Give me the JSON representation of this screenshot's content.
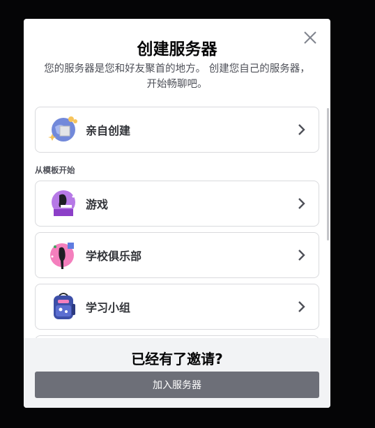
{
  "modal": {
    "title": "创建服务器",
    "subtitle": "您的服务器是您和好友聚首的地方。 创建您自己的服务器，开始畅聊吧。",
    "close_icon": "close-icon"
  },
  "create_own": {
    "label": "亲自创建",
    "icon": "globe-sparkle-icon"
  },
  "templates": {
    "header": "从模板开始",
    "items": [
      {
        "label": "游戏",
        "icon": "gaming-icon"
      },
      {
        "label": "学校俱乐部",
        "icon": "school-club-icon"
      },
      {
        "label": "学习小组",
        "icon": "backpack-icon"
      }
    ]
  },
  "footer": {
    "title": "已经有了邀请?",
    "join_label": "加入服务器"
  },
  "colors": {
    "overlay": "#050506",
    "card_border": "#d9dadd",
    "button": "#6d6f78",
    "footer_bg": "#f2f3f5"
  }
}
